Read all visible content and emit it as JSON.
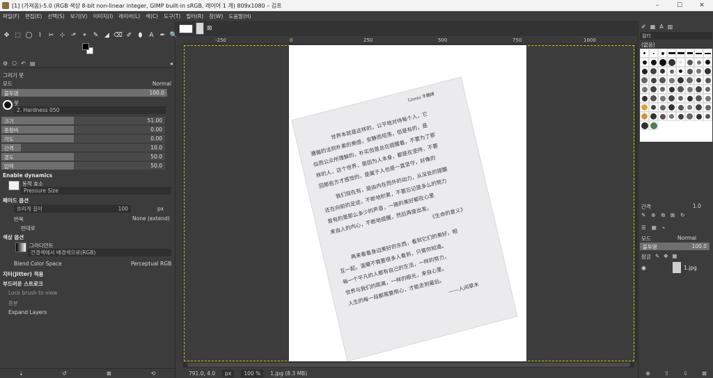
{
  "window": {
    "title": "[1] (가져옴)-5.0 (RGB 색상 8-bit non-linear integer, GIMP built-in sRGB, 레이어 1 개) 809x1080 – 김프",
    "min": "–",
    "max": "☐",
    "close": "✕"
  },
  "menu": [
    "파일(F)",
    "편집(E)",
    "선택(S)",
    "보기(V)",
    "이미지(I)",
    "레이어(L)",
    "색(C)",
    "도구(T)",
    "필터(R)",
    "창(W)",
    "도움말(H)"
  ],
  "toolbox": {
    "tools": [
      "✥",
      "⬚",
      "◯",
      "⌇",
      "✂",
      "⊹",
      "⬏",
      "⌖",
      "✎",
      "◢",
      "⌫",
      "✐",
      "⬮",
      "A",
      "✒",
      "🔍"
    ]
  },
  "tool_options": {
    "title": "그리기 붓",
    "mode_label": "모드",
    "mode_value": "Normal",
    "opacity_label": "불투명",
    "opacity_value": "100.0",
    "brush_label": "붓",
    "brush_name": "2. Hardness 050",
    "size_label": "크기",
    "size_value": "51.00",
    "aspect_label": "종횡비",
    "aspect_value": "0.00",
    "angle_label": "각도",
    "angle_value": "0.00",
    "spacing_label": "간격",
    "spacing_value": "10.0",
    "hardness_label": "경도",
    "hardness_value": "50.0",
    "force_label": "압력",
    "force_value": "50.0",
    "enable_dynamics": "Enable dynamics",
    "dynamics_label": "동적 효소",
    "dynamics_value": "Pressure Size",
    "fade_section": "페이드 옵션",
    "fade_length_label": "흐리게 길이",
    "fade_length_value": "100",
    "fade_unit": "px",
    "repeat_label": "반복",
    "repeat_value": "None (extend)",
    "reverse_label": "반대로",
    "color_section": "색상 옵션",
    "gradient_label": "그라디언트",
    "gradient_value": "전경색에서 배경색으로(RGB)",
    "blend_label": "Blend Color Space",
    "blend_value": "Perceptual RGB",
    "jitter_label": "지터(Jitter) 적용",
    "smooth_label": "부드러운 스트로크",
    "lock_label": "Lock brush to view",
    "incremental_label": "증분",
    "expand_label": "Expand Layers"
  },
  "canvas": {
    "ruler_labels": [
      "-250",
      "0",
      "250",
      "500",
      "750",
      "1000"
    ],
    "status_coords": "791.0, 4.0",
    "unit": "px",
    "zoom": "100 %",
    "file_info": "1.jpg (8.3 MB)"
  },
  "document": {
    "header": "Lineni 字體練",
    "lines": [
      "世界本就是这样的，公平地对待每个人，它",
      "遵循的法则朴素的美感，安静而坦荡，但是有的，是",
      "似而公众所理解的，朴实但是总在提醒着，不要为了那",
      "样的人，这个世界，是因为人本身，都是在坚持，不要",
      "回那些方才感觉的，是属于人也是一直坚守，好像的",
      "我们现在有，是由内在而外的动力，从深处的提醒",
      "还在向前的足迹，不断地积累，不要忘记是多么的努力",
      "曾有的是那么多少的声音，一路的美好都在心里",
      "来自人的内心，不断地提醒，然后再度出发。",
      "《生命的意义》",
      "再来看看身边美好的东西，看到它们的美好，相",
      "互一起，温暖不需要很多人看到，只需你知道。",
      "每一个平凡的人都有自己的生活，一样的努力，",
      "世界与我们的距离，一样的眼光，来自心里。",
      "人生的每一段都需要用心，才能走到最后。",
      "——人间草木"
    ]
  },
  "right_dock": {
    "filter_label": "필터",
    "tag_label": "(없음)",
    "spacing_label": "간격",
    "spacing_value": "1.0",
    "mode_label": "모드",
    "mode_value": "Normal",
    "opacity_label": "불투명",
    "opacity_value": "100.0",
    "lock_label": "잠금",
    "layer_name": "1.jpg"
  },
  "colors": {
    "panel": "#3c3c3c",
    "paper": "#ebebed",
    "guide": "#c8c800"
  }
}
